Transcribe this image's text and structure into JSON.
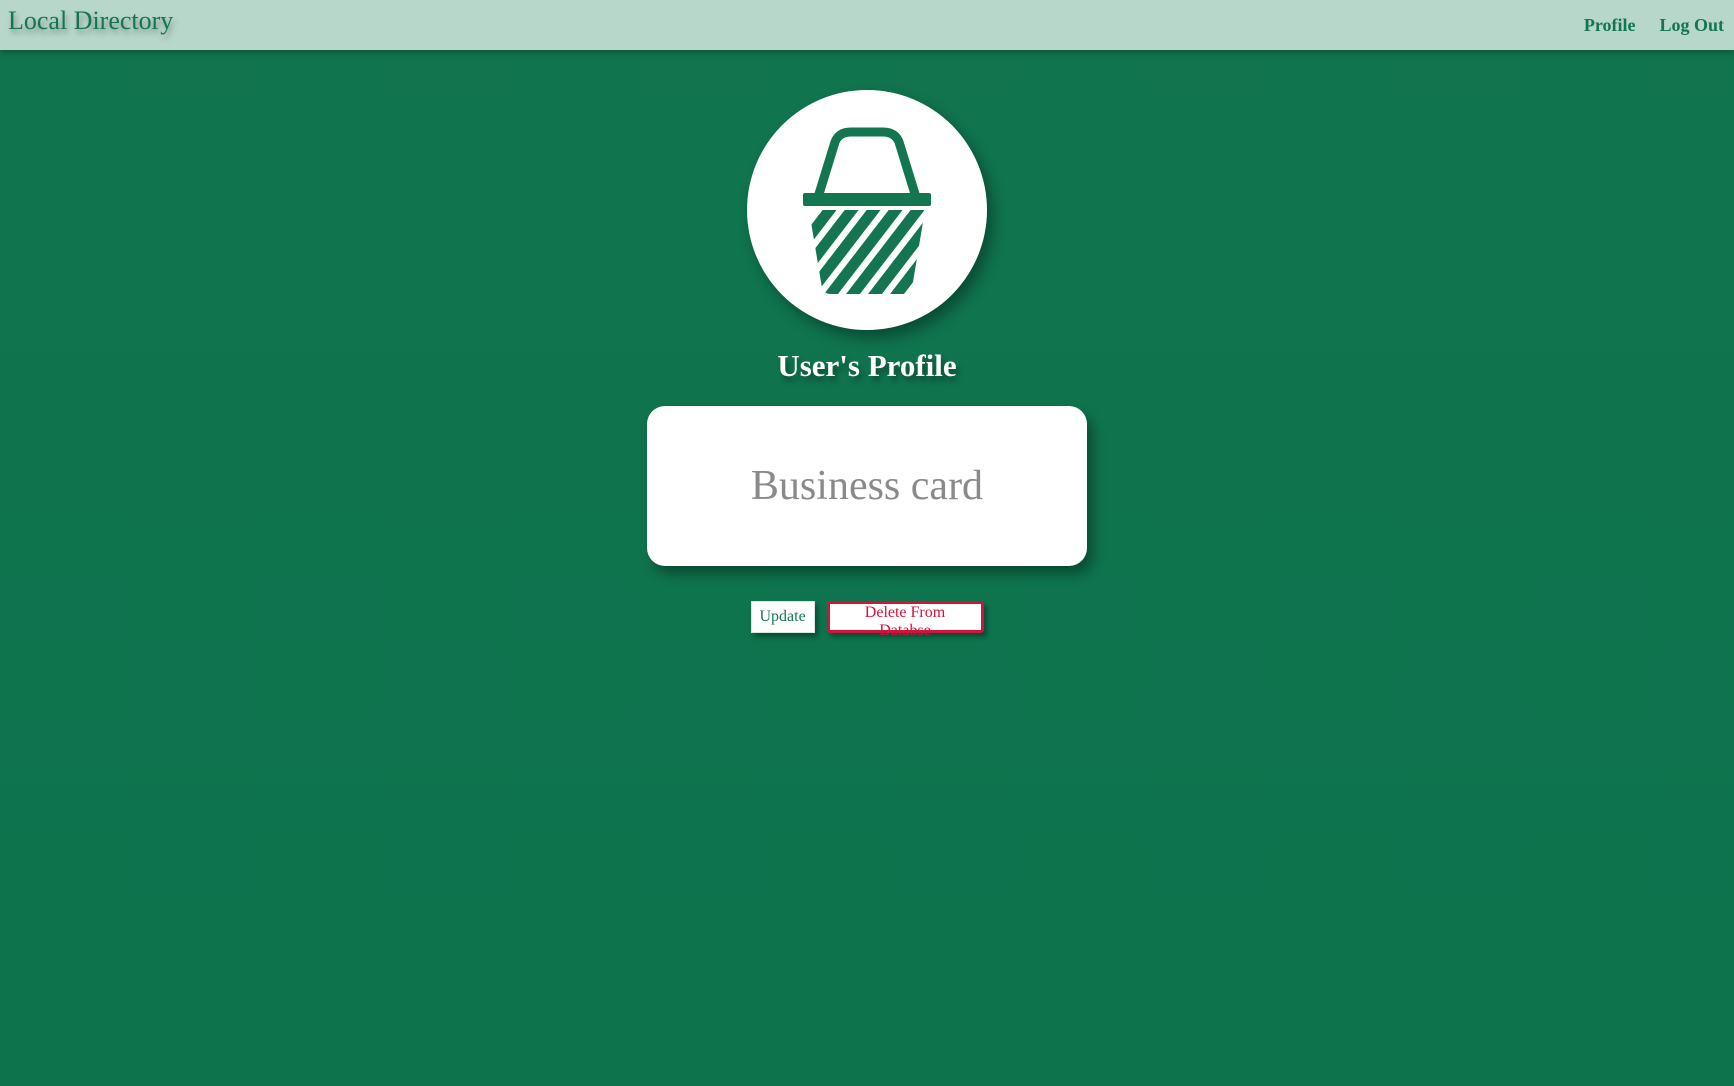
{
  "navbar": {
    "brand": "Local Directory",
    "links": [
      {
        "label": "Profile"
      },
      {
        "label": "Log Out"
      }
    ]
  },
  "avatar": {
    "icon": "basket-icon"
  },
  "profile": {
    "title": "User's Profile"
  },
  "card": {
    "text": "Business card"
  },
  "actions": {
    "update_label": "Update",
    "delete_label": "Delete From Databse"
  },
  "colors": {
    "background": "#0f7450",
    "navbar": "#b8d7cb",
    "brand": "#137651",
    "danger": "#d0143c",
    "card_text": "#8a8a8a"
  }
}
